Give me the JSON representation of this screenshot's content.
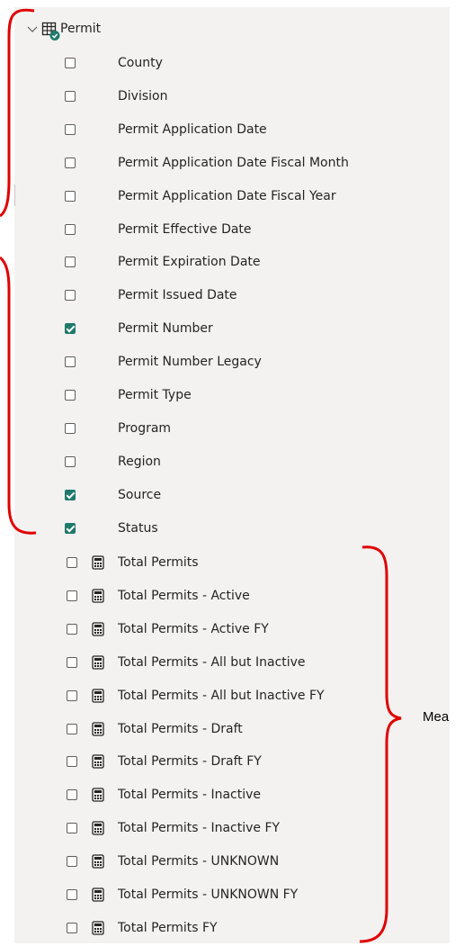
{
  "table": {
    "name": "Permit",
    "icon": "table-with-check-icon",
    "expanded": true
  },
  "columns": [
    {
      "label": "County",
      "checked": false
    },
    {
      "label": "Division",
      "checked": false
    },
    {
      "label": "Permit Application Date",
      "checked": false
    },
    {
      "label": "Permit Application Date Fiscal Month",
      "checked": false
    },
    {
      "label": "Permit Application Date Fiscal Year",
      "checked": false
    },
    {
      "label": "Permit Effective Date",
      "checked": false
    },
    {
      "label": "Permit Expiration Date",
      "checked": false
    },
    {
      "label": "Permit Issued Date",
      "checked": false
    },
    {
      "label": "Permit Number",
      "checked": true
    },
    {
      "label": "Permit Number Legacy",
      "checked": false
    },
    {
      "label": "Permit Type",
      "checked": false
    },
    {
      "label": "Program",
      "checked": false
    },
    {
      "label": "Region",
      "checked": false
    },
    {
      "label": "Source",
      "checked": true
    },
    {
      "label": "Status",
      "checked": true
    }
  ],
  "measures": [
    {
      "label": "Total Permits",
      "checked": false,
      "icon": "calculator-icon"
    },
    {
      "label": "Total Permits - Active",
      "checked": false,
      "icon": "calculator-icon"
    },
    {
      "label": "Total Permits - Active FY",
      "checked": false,
      "icon": "calculator-icon"
    },
    {
      "label": "Total Permits - All but Inactive",
      "checked": false,
      "icon": "calculator-icon"
    },
    {
      "label": "Total Permits - All but Inactive FY",
      "checked": false,
      "icon": "calculator-icon"
    },
    {
      "label": "Total Permits - Draft",
      "checked": false,
      "icon": "calculator-icon"
    },
    {
      "label": "Total Permits - Draft FY",
      "checked": false,
      "icon": "calculator-icon"
    },
    {
      "label": "Total Permits - Inactive",
      "checked": false,
      "icon": "calculator-icon"
    },
    {
      "label": "Total Permits - Inactive FY",
      "checked": false,
      "icon": "calculator-icon"
    },
    {
      "label": "Total Permits - UNKNOWN",
      "checked": false,
      "icon": "calculator-icon"
    },
    {
      "label": "Total Permits - UNKNOWN FY",
      "checked": false,
      "icon": "calculator-icon"
    },
    {
      "label": "Total Permits FY",
      "checked": false,
      "icon": "calculator-icon"
    }
  ],
  "annotation": {
    "measures_label": "Mea"
  },
  "colors": {
    "checked": "#1f7a6b",
    "bracket": "#e00000",
    "panel": "#f3f2f1"
  }
}
